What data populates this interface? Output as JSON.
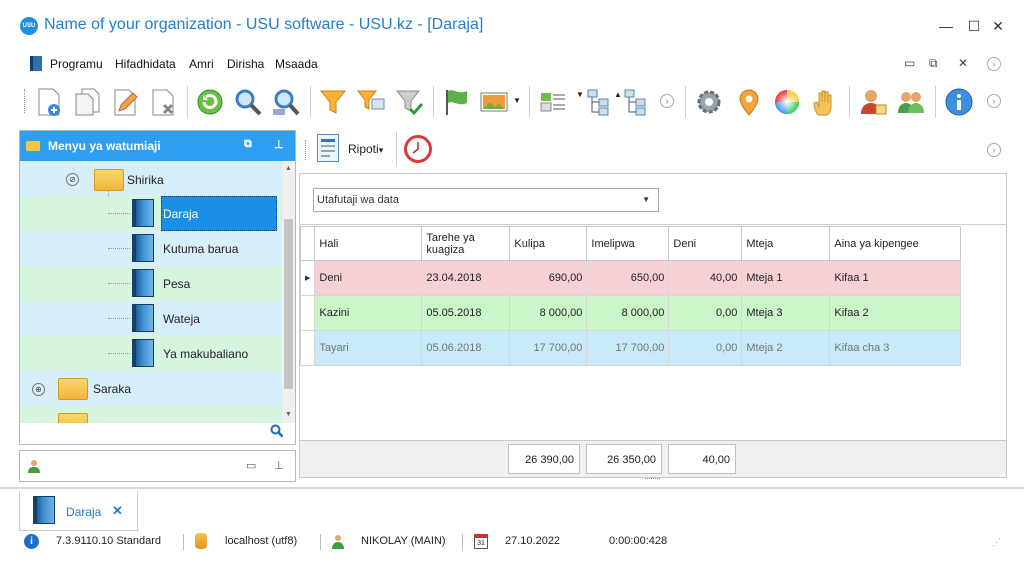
{
  "window": {
    "logo": "USU",
    "title": "Name of your organization - USU software - USU.kz - [Daraja]",
    "minimize": "—",
    "maximize": "☐",
    "close": "✕"
  },
  "menu": {
    "items": [
      "Programu",
      "Hifadhidata",
      "Amri",
      "Dirisha",
      "Msaada"
    ],
    "mdi_minimize": "▭",
    "mdi_restore": "⧉",
    "mdi_close": "✕"
  },
  "toolbar": {
    "icons": [
      "add-record-icon",
      "copy-record-icon",
      "edit-record-icon",
      "delete-record-icon",
      "refresh-icon",
      "search-icon",
      "search-advanced-icon",
      "filter-icon",
      "filter-by-cell-icon",
      "clear-filter-icon",
      "flag-icon",
      "image-icon",
      "expand-all-icon",
      "tree-collapse-icon",
      "tree-expand-icon",
      "settings-gear-icon",
      "map-pin-icon",
      "color-wheel-icon",
      "hand-icon",
      "user-card-icon",
      "users-group-icon",
      "info-icon"
    ]
  },
  "left_panel": {
    "title": "Menyu ya watumiaji",
    "tree": [
      {
        "label": "Shirika",
        "type": "folder",
        "level": 1,
        "expand": "⊘"
      },
      {
        "label": "Daraja",
        "type": "book",
        "level": 2,
        "selected": true
      },
      {
        "label": "Kutuma barua",
        "type": "book",
        "level": 2
      },
      {
        "label": "Pesa",
        "type": "book",
        "level": 2
      },
      {
        "label": "Wateja",
        "type": "book",
        "level": 2
      },
      {
        "label": "Ya makubaliano",
        "type": "book",
        "level": 2
      },
      {
        "label": "Saraka",
        "type": "folder",
        "level": 0,
        "expand": "⊕"
      }
    ]
  },
  "right_toolbar": {
    "report_label": "Ripoti",
    "report_dropdown": "▾"
  },
  "filter": {
    "value": "Utafutaji wa data"
  },
  "grid": {
    "columns": [
      "Hali",
      "Tarehe ya kuagiza",
      "Kulipa",
      "Imelipwa",
      "Deni",
      "Mteja",
      "Aina ya kipengee"
    ],
    "rows": [
      {
        "status": "Deni",
        "date": "23.04.2018",
        "to_pay": "690,00",
        "paid": "650,00",
        "debt": "40,00",
        "client": "Mteja 1",
        "item_type": "Kifaa 1",
        "color": "#f7d0d6",
        "indicator": "▶"
      },
      {
        "status": "Kazini",
        "date": "05.05.2018",
        "to_pay": "8 000,00",
        "paid": "8 000,00",
        "debt": "0,00",
        "client": "Mteja 3",
        "item_type": "Kifaa 2",
        "color": "#c9f5c9",
        "indicator": ""
      },
      {
        "status": "Tayari",
        "date": "05.06.2018",
        "to_pay": "17 700,00",
        "paid": "17 700,00",
        "debt": "0,00",
        "client": "Mteja 2",
        "item_type": "Kifaa cha 3",
        "color": "#c7e9f8",
        "indicator": ""
      }
    ],
    "totals": {
      "to_pay": "26 390,00",
      "paid": "26 350,00",
      "debt": "40,00"
    }
  },
  "tab": {
    "label": "Daraja",
    "close": "✕"
  },
  "status": {
    "version": "7.3.9110.10 Standard",
    "server": "localhost (utf8)",
    "user": "NIKOLAY (MAIN)",
    "calendar_day": "31",
    "date": "27.10.2022",
    "timer": "0:00:00:428"
  }
}
